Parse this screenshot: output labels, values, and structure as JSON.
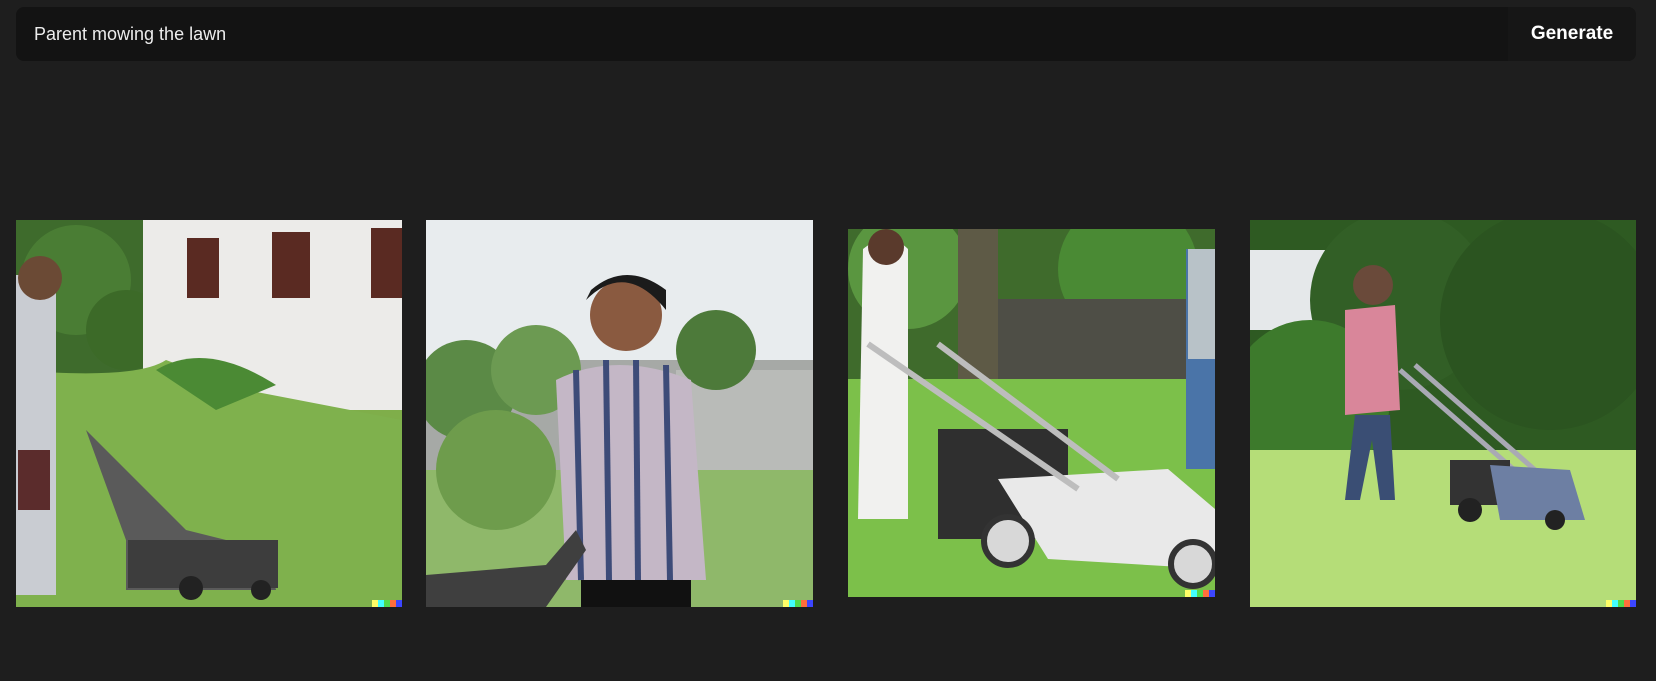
{
  "prompt": {
    "value": "Parent mowing the lawn"
  },
  "actions": {
    "generate_label": "Generate"
  },
  "results": [
    {
      "name": "result-image-1",
      "subject": "man with lawn mower beside white building"
    },
    {
      "name": "result-image-2",
      "subject": "woman in striped top pushing mower"
    },
    {
      "name": "result-image-3",
      "subject": "woman in white dress with white lawn mower"
    },
    {
      "name": "result-image-4",
      "subject": "woman in pink shirt mowing grass"
    }
  ],
  "colors": {
    "background": "#1e1e1e",
    "bar": "#131313",
    "text": "#ececec",
    "signature": [
      "#ffff66",
      "#42ffff",
      "#51da4c",
      "#ff6e3c",
      "#3c46ff"
    ]
  }
}
